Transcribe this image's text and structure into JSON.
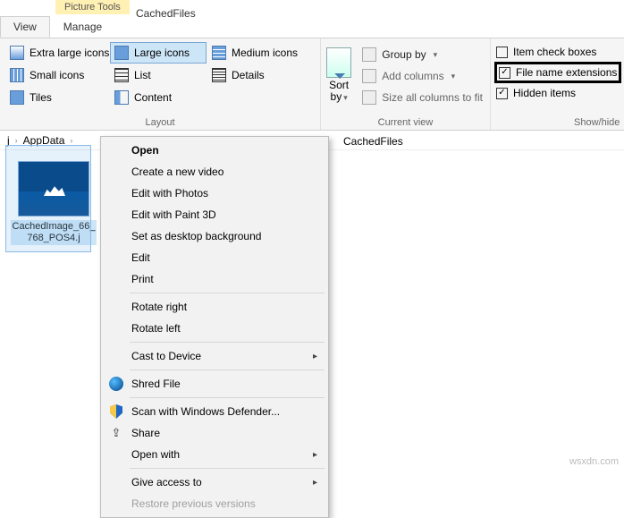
{
  "title": "CachedFiles",
  "context_tab": "Picture Tools",
  "tabs": {
    "view": "View",
    "manage": "Manage"
  },
  "ribbon": {
    "layout": {
      "label": "Layout",
      "extra_large": "Extra large icons",
      "large": "Large icons",
      "medium": "Medium icons",
      "small": "Small icons",
      "list": "List",
      "details": "Details",
      "tiles": "Tiles",
      "content": "Content"
    },
    "current_view": {
      "label": "Current view",
      "sort_by": "Sort by",
      "group_by": "Group by",
      "add_columns": "Add columns",
      "size_all": "Size all columns to fit"
    },
    "show_hide": {
      "label": "Show/hide",
      "item_check": "Item check boxes",
      "file_ext": "File name extensions",
      "hidden": "Hidden items"
    }
  },
  "breadcrumb": {
    "a": "j",
    "b": "AppData",
    "c": "",
    "right": "CachedFiles"
  },
  "file": {
    "name": "CachedImage_66_768_POS4.j"
  },
  "menu": {
    "open": "Open",
    "new_video": "Create a new video",
    "edit_photos": "Edit with Photos",
    "edit_paint3d": "Edit with Paint 3D",
    "set_bg": "Set as desktop background",
    "edit": "Edit",
    "print": "Print",
    "rotate_r": "Rotate right",
    "rotate_l": "Rotate left",
    "cast": "Cast to Device",
    "shred": "Shred File",
    "defender": "Scan with Windows Defender...",
    "share": "Share",
    "open_with": "Open with",
    "give_access": "Give access to",
    "restore": "Restore previous versions"
  },
  "watermark": "wsxdn.com"
}
